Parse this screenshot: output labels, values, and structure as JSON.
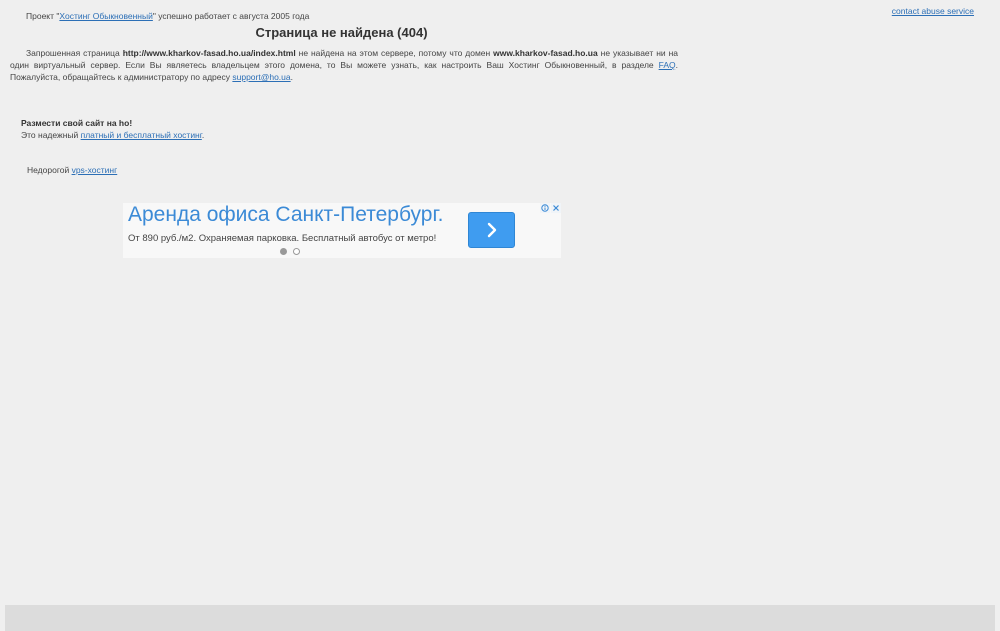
{
  "header": {
    "prefix": "Проект \"",
    "hosting_link": "Хостинг Обыкновенный",
    "suffix": "\" успешно работает с августа 2005 года",
    "abuse_link": "contact abuse service"
  },
  "title": "Страница не найдена (404)",
  "message": {
    "part1": "Запрошенная страница ",
    "url": "http://www.kharkov-fasad.ho.ua/index.html",
    "part2": " не найдена на этом сервере, потому что домен ",
    "domain": "www.kharkov-fasad.ho.ua",
    "part3": " не указывает ни на один виртуальный сервер. Если Вы являетесь владельцем этого домена, то Вы можете узнать, как настроить Ваш Хостинг Обыкновенный, в разделе ",
    "faq_link": "FAQ",
    "part4": ". Пожалуйста, обращайтесь к администратору по адресу ",
    "support_link": "support@ho.ua",
    "part5": "."
  },
  "promo": {
    "heading": "Размести свой сайт на ho!",
    "text_prefix": "Это надежный ",
    "link": "платный и бесплатный хостинг",
    "text_suffix": "."
  },
  "vps": {
    "prefix": "Недорогой ",
    "link": "vps-хостинг"
  },
  "ad": {
    "title": "Аренда офиса Санкт-Петербург.",
    "text": "От 890 руб./м2. Охраняемая парковка. Бесплатный автобус от метро!",
    "button_icon": "chevron-right-icon",
    "accent_color": "#3f9cf0",
    "title_color": "#3b8ad6"
  }
}
